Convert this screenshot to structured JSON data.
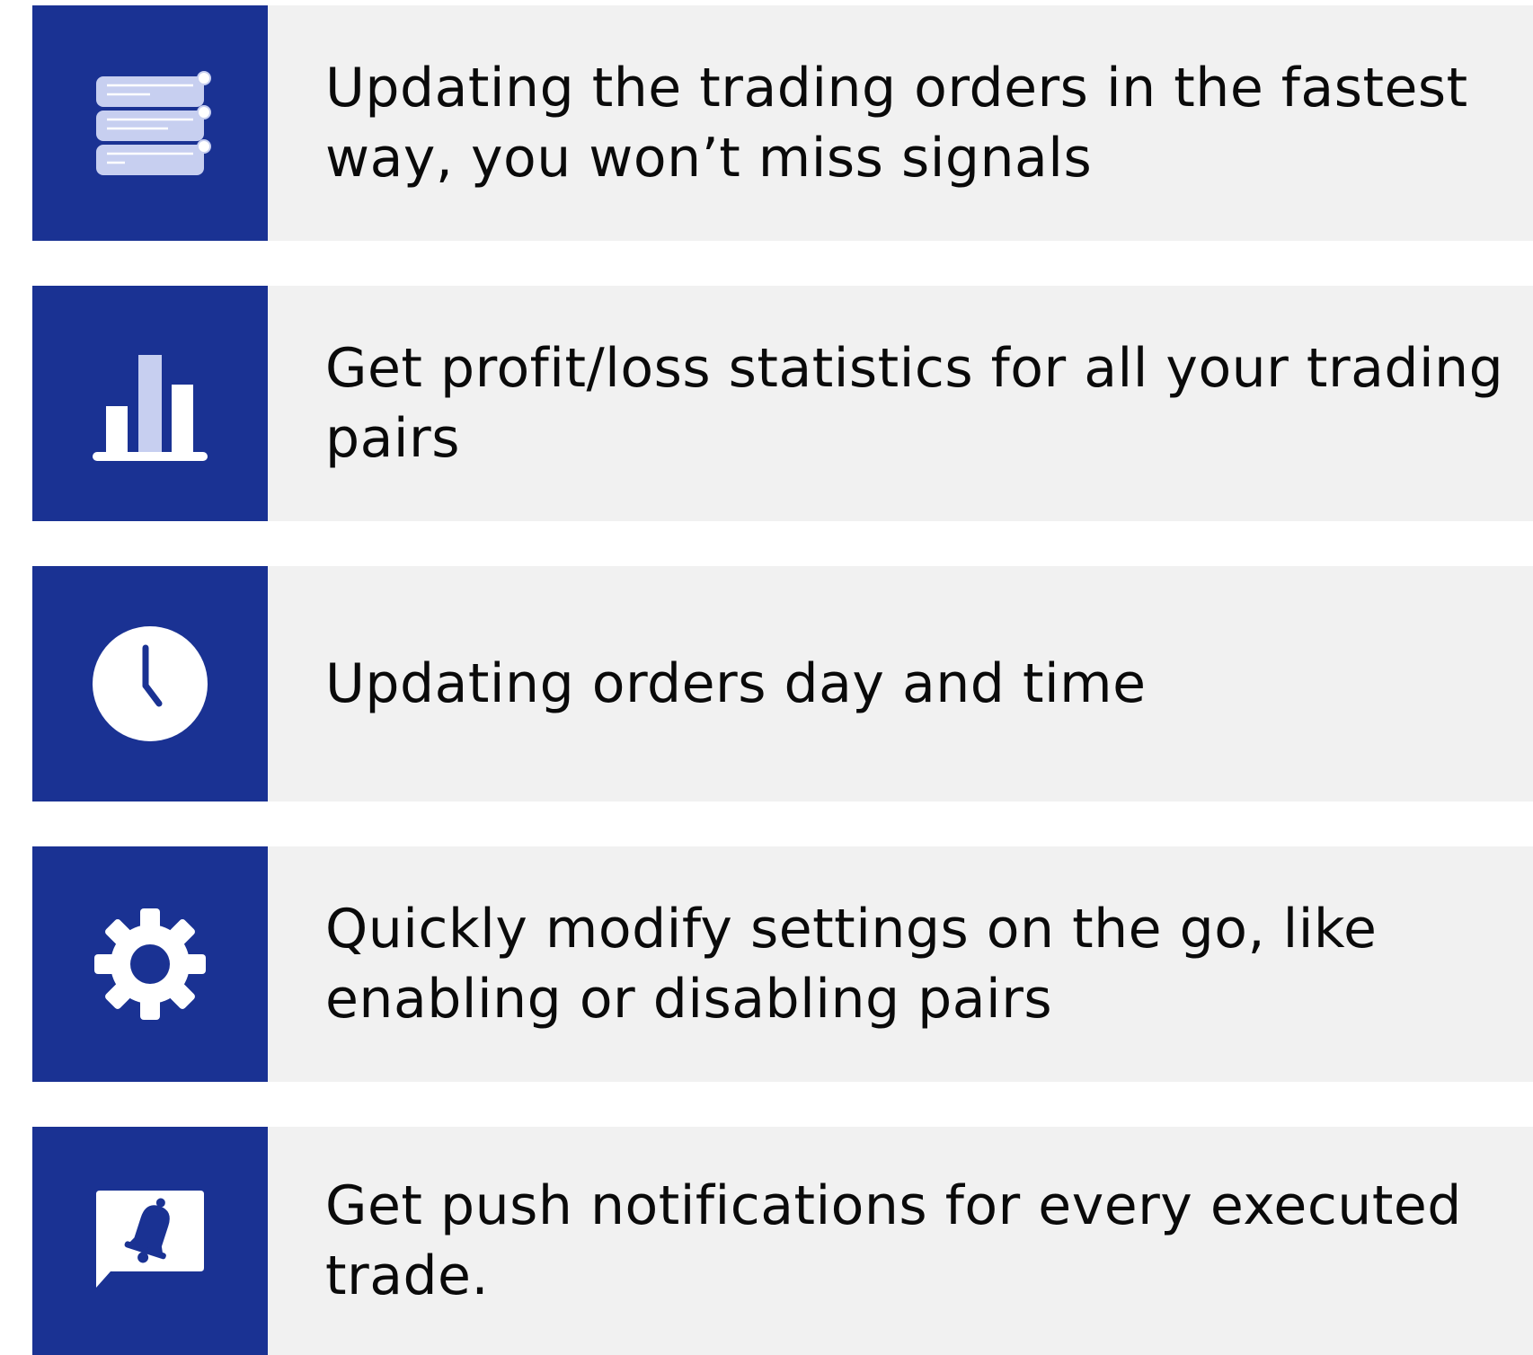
{
  "colors": {
    "icon_background": "#1a3293",
    "text_background": "#f1f1f1",
    "icon_light": "#c7cff0",
    "icon_white": "#ffffff",
    "text": "#0a0a0a"
  },
  "features": [
    {
      "icon": "order-list-icon",
      "text": "Updating the trading orders in the fastest way, you won’t miss signals"
    },
    {
      "icon": "bar-chart-icon",
      "text": "Get profit/loss statistics for all your trading pairs"
    },
    {
      "icon": "clock-icon",
      "text": "Updating orders day and time"
    },
    {
      "icon": "gear-icon",
      "text": "Quickly modify settings on the go, like enabling or disabling pairs"
    },
    {
      "icon": "bell-notification-icon",
      "text": "Get push notifications for every executed trade."
    }
  ]
}
